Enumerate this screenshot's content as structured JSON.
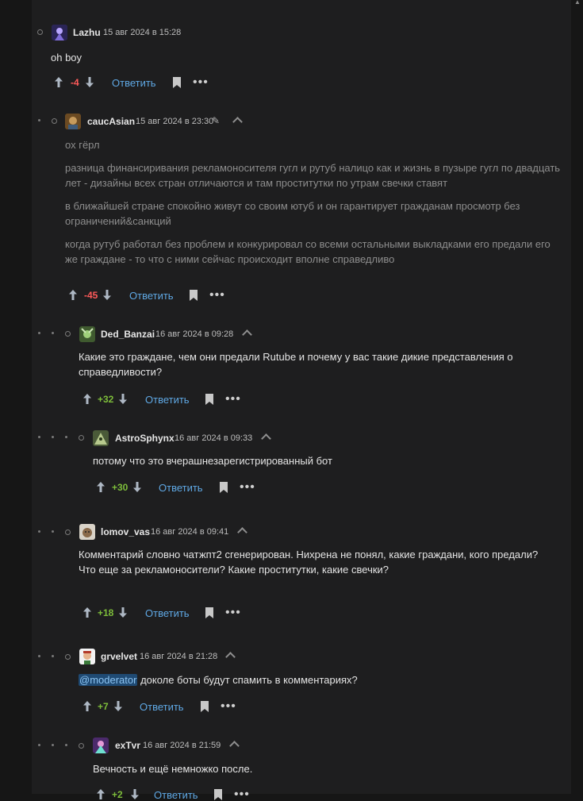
{
  "actions": {
    "reply_label": "Ответить"
  },
  "comments": [
    {
      "author": "Lazhu",
      "date": "15 авг 2024 в 15:28",
      "score": "-4",
      "paragraphs": [
        "oh boy"
      ]
    },
    {
      "author": "caucAsian",
      "date": "15 авг 2024 в 23:30",
      "score": "-45",
      "paragraphs": [
        "ох гёрл",
        "разница финансиривания рекламоносителя гугл и рутуб налицо как и жизнь в пузыре гугл по двадцать лет - дизайны всех стран отличаются и там проститутки по утрам свечки ставят",
        "в ближайшей стране спокойно живут со своим ютуб и он гарантирует гражданам просмотр без ограничений&санкций",
        "когда рутуб работал без проблем и конкурировал со всеми остальными выкладками его предали его же граждане - то что с ними сейчас происходит вполне справедливо"
      ]
    },
    {
      "author": "Ded_Banzai",
      "date": "16 авг 2024 в 09:28",
      "score": "+32",
      "paragraphs": [
        "Какие это граждане, чем они предали Rutube и почему у вас такие дикие представления о справедливости?"
      ]
    },
    {
      "author": "AstroSphynx",
      "date": "16 авг 2024 в 09:33",
      "score": "+30",
      "paragraphs": [
        "потому что это вчерашнезарегистрированный бот"
      ]
    },
    {
      "author": "lomov_vas",
      "date": "16 авг 2024 в 09:41",
      "score": "+18",
      "paragraphs": [
        "Комментарий словно чатжпт2 сгенерирован. Нихрена не понял, какие граждани, кого предали? Что еще за рекламоносители? Какие проститутки, какие свечки?"
      ]
    },
    {
      "author": "grvelvet",
      "date": "16 авг 2024 в 21:28",
      "score": "+7",
      "mention": "@moderator",
      "text_after_mention": " доколе боты будут спамить в комментариях?"
    },
    {
      "author": "exTvr",
      "date": "16 авг 2024 в 21:59",
      "score": "+2",
      "paragraphs": [
        "Вечность и ещё немножко после."
      ]
    }
  ],
  "icons": [
    "upvote-arrow-icon",
    "downvote-arrow-icon",
    "bookmark-icon",
    "more-dots-icon",
    "collapse-chevron-icon",
    "edit-pencil-icon"
  ],
  "colors": {
    "negative": "#ff5a5a",
    "positive": "#7dbd3a",
    "link": "#5fa8e4"
  }
}
